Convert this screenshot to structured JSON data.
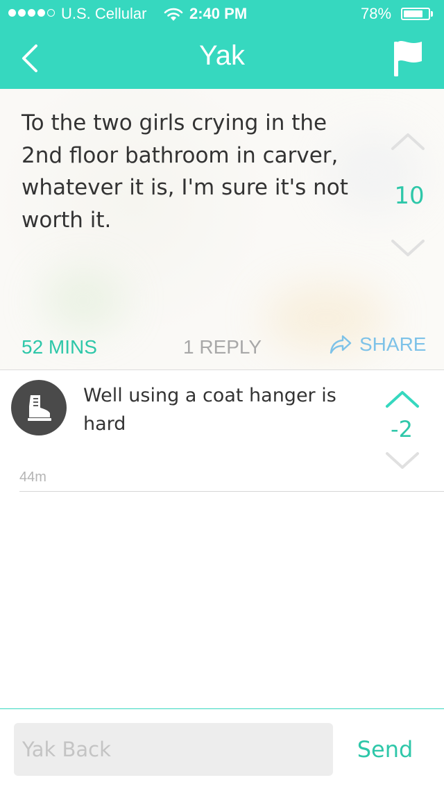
{
  "status_bar": {
    "carrier": "U.S. Cellular",
    "time": "2:40 PM",
    "battery_percent": "78%",
    "battery_level": 0.78,
    "signal_bars_filled": 4,
    "signal_bars_total": 5
  },
  "nav": {
    "title": "Yak",
    "back_icon": "chevron-left-icon",
    "flag_icon": "flag-icon"
  },
  "post": {
    "text": "To the two girls crying in the 2nd floor bathroom in carver, whatever it is, I'm sure it's not worth it.",
    "votes": "10",
    "time": "52 MINS",
    "replies": "1 REPLY",
    "share_label": "SHARE"
  },
  "comment": {
    "text": "Well using a coat hanger is hard",
    "votes": "-2",
    "time": "44m",
    "avatar_icon": "boot-icon"
  },
  "reply_bar": {
    "placeholder": "Yak Back",
    "send_label": "Send"
  },
  "colors": {
    "brand": "#36d8bf",
    "accent_text": "#2ec7a9",
    "share": "#7dc2e8",
    "muted": "#a8a8a8"
  }
}
